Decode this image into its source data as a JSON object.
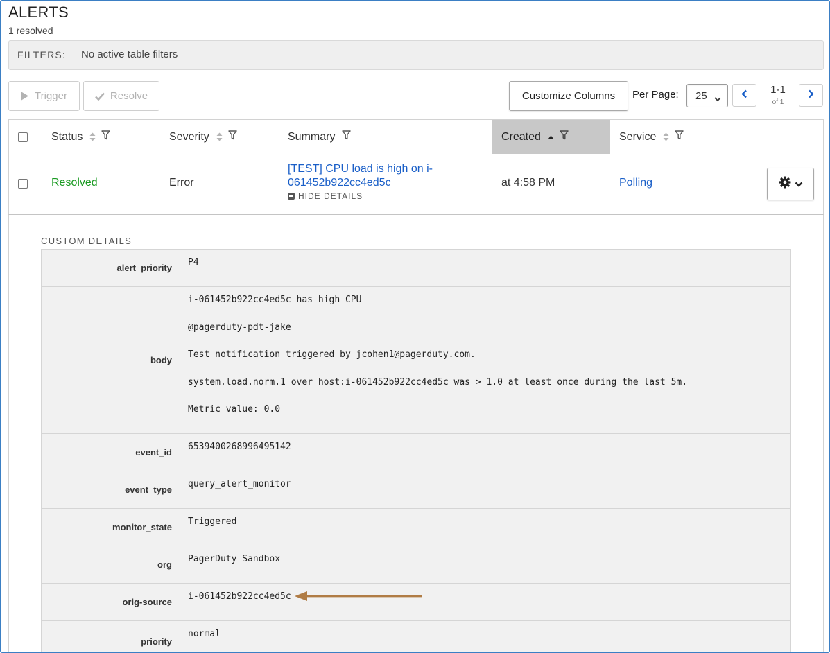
{
  "header": {
    "title": "ALERTS",
    "count_text": "1 resolved"
  },
  "filters": {
    "label": "FILTERS:",
    "value": "No active table filters"
  },
  "toolbar": {
    "trigger_label": "Trigger",
    "resolve_label": "Resolve",
    "customize_label": "Customize Columns",
    "per_page_label": "Per Page:",
    "per_page_value": "25",
    "page_range": "1-1",
    "page_of": "of 1"
  },
  "columns": {
    "status": "Status",
    "severity": "Severity",
    "summary": "Summary",
    "created": "Created",
    "service": "Service"
  },
  "alert": {
    "status": "Resolved",
    "severity": "Error",
    "summary": "[TEST] CPU load is high on i-061452b922cc4ed5c",
    "hide_details": "HIDE DETAILS",
    "created": "at 4:58 PM",
    "service": "Polling"
  },
  "details": {
    "title": "CUSTOM DETAILS",
    "alert_priority_key": "alert_priority",
    "alert_priority": "P4",
    "body_key": "body",
    "body_line1": "i-061452b922cc4ed5c has high CPU",
    "body_line2": "@pagerduty-pdt-jake",
    "body_line3": "Test notification triggered by jcohen1@pagerduty.com.",
    "body_line4": "system.load.norm.1 over host:i-061452b922cc4ed5c was > 1.0 at least once during the last 5m.",
    "body_line5": "Metric value: 0.0",
    "event_id_key": "event_id",
    "event_id": "6539400268996495142",
    "event_type_key": "event_type",
    "event_type": "query_alert_monitor",
    "monitor_state_key": "monitor_state",
    "monitor_state": "Triggered",
    "org_key": "org",
    "org": "PagerDuty Sandbox",
    "orig_source_key": "orig-source",
    "orig_source": "i-061452b922cc4ed5c",
    "priority_key": "priority",
    "priority": "normal"
  },
  "colors": {
    "accent_link": "#1a5fc8",
    "resolved_green": "#1a9a22",
    "annotation_arrow": "#b07c45"
  }
}
